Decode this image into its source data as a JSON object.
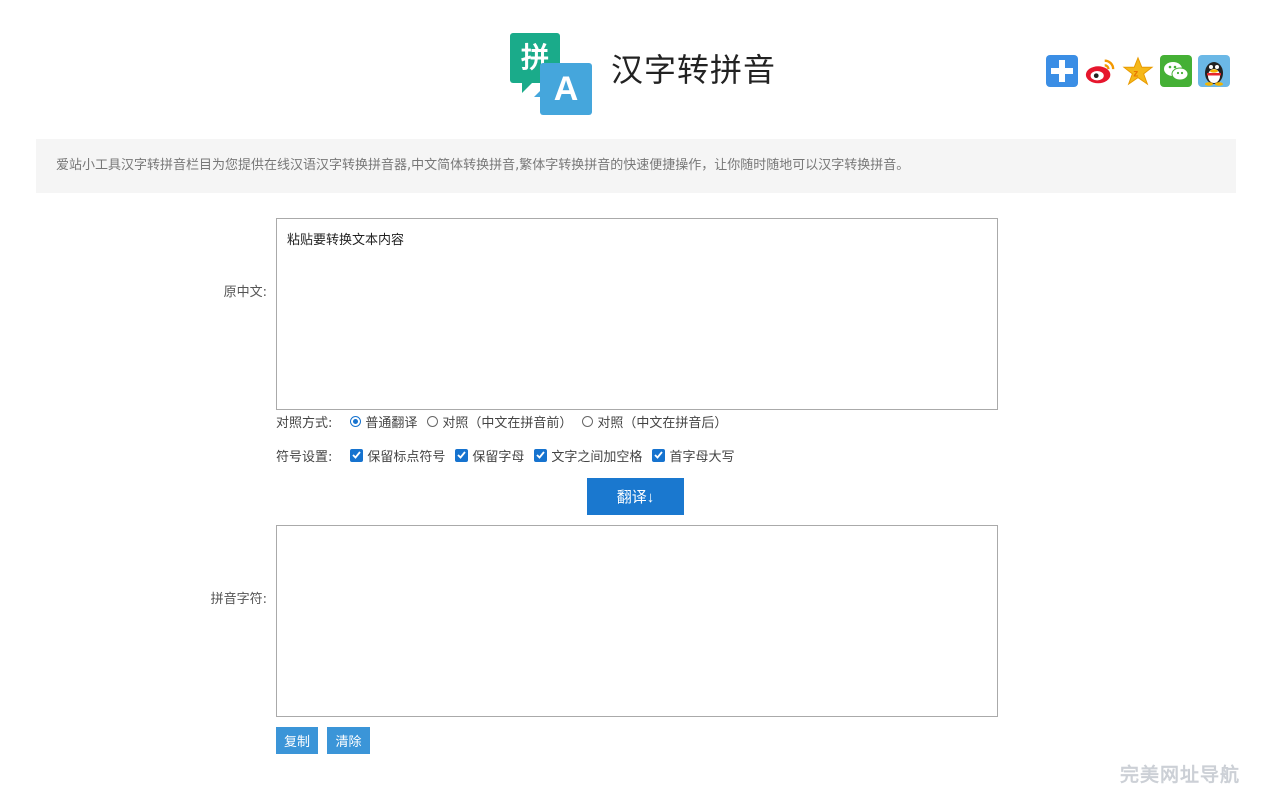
{
  "header": {
    "logo_glyph_top": "拼",
    "logo_glyph_bottom": "A",
    "title": "汉字转拼音",
    "share_icons": [
      "plus-share-icon",
      "weibo-icon",
      "qzone-icon",
      "wechat-icon",
      "qq-icon"
    ]
  },
  "intro": {
    "text": "爱站小工具汉字转拼音栏目为您提供在线汉语汉字转换拼音器,中文简体转换拼音,繁体字转换拼音的快速便捷操作，让你随时随地可以汉字转换拼音。"
  },
  "form": {
    "source_label": "原中文:",
    "source_placeholder": "粘贴要转换文本内容",
    "source_value": "",
    "mode_label": "对照方式:",
    "mode_options": [
      "普通翻译",
      "对照（中文在拼音前）",
      "对照（中文在拼音后）"
    ],
    "mode_selected": "普通翻译",
    "symbol_label": "符号设置:",
    "symbol_options": [
      "保留标点符号",
      "保留字母",
      "文字之间加空格",
      "首字母大写"
    ],
    "symbol_checked": [
      true,
      true,
      true,
      true
    ],
    "translate_button": "翻译↓",
    "result_label": "拼音字符:",
    "result_value": "",
    "copy_button": "复制",
    "clear_button": "清除"
  },
  "watermark": "完美网址导航",
  "colors": {
    "primary": "#1a78cf",
    "small_button": "#3b95d8",
    "logo_green": "#1aab8a",
    "logo_blue": "#45a6dc",
    "intro_bg": "#f5f5f5"
  }
}
